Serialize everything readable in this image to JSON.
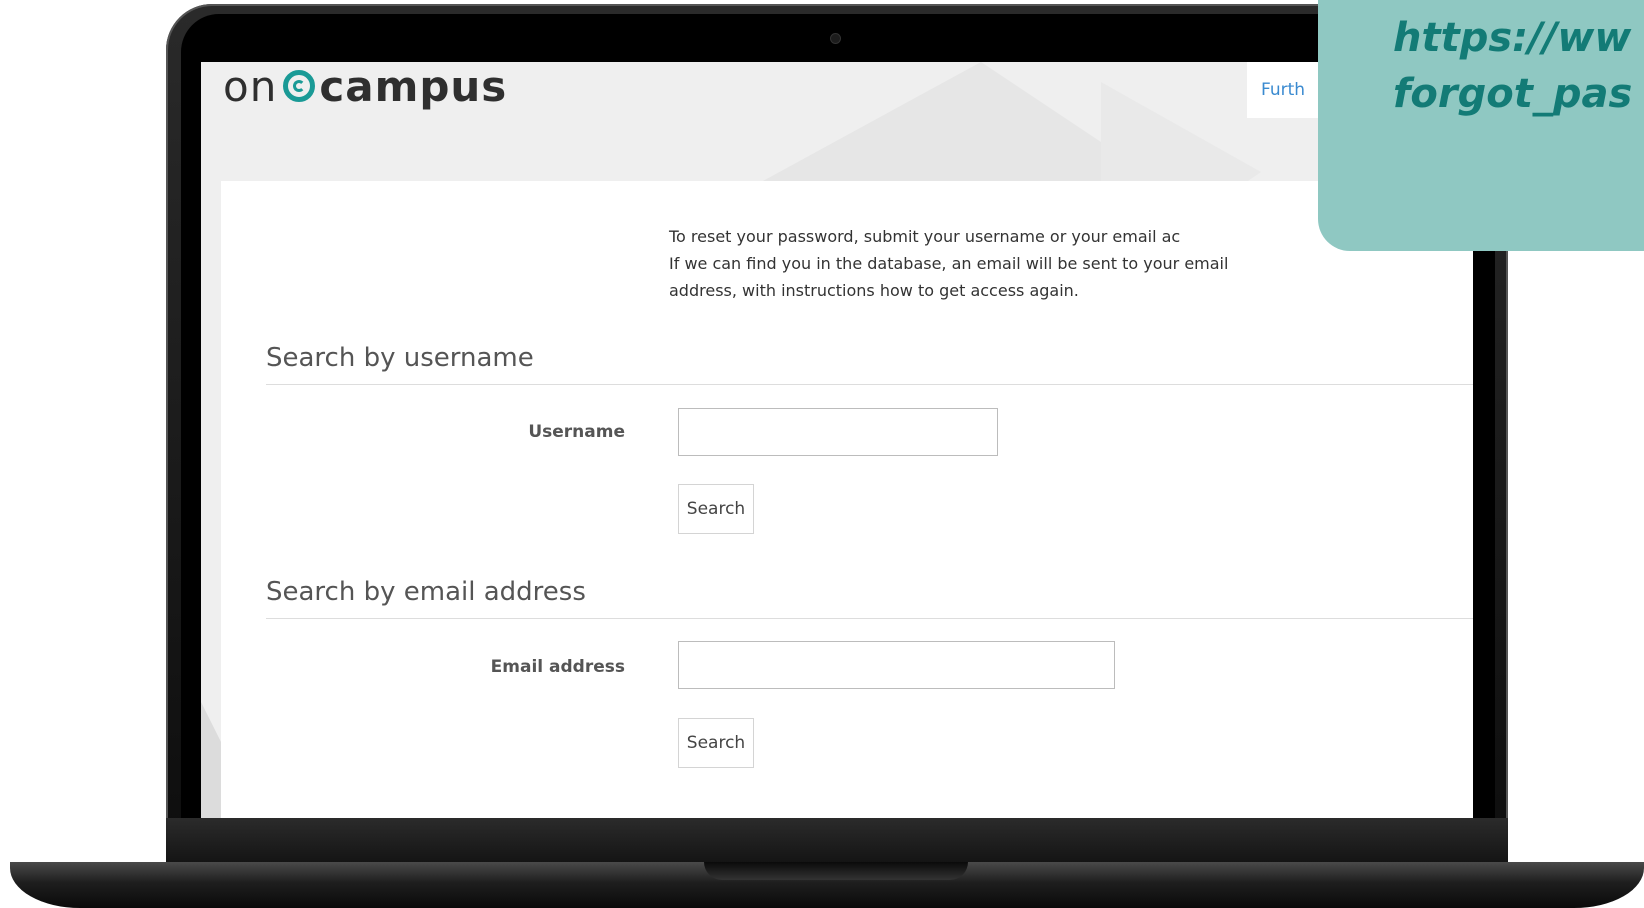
{
  "logo": {
    "prefix": "on",
    "suffix": "campus"
  },
  "header": {
    "further_link": "Furth"
  },
  "intro": {
    "text": "To reset your password, submit your username or your email ac\nIf we can find you in the database, an email will be sent to your email\naddress, with instructions how to get access again."
  },
  "username_section": {
    "title": "Search by username",
    "label": "Username",
    "value": "",
    "button": "Search"
  },
  "email_section": {
    "title": "Search by email address",
    "label": "Email address",
    "value": "",
    "button": "Search"
  },
  "url_overlay": {
    "text": "https://ww\nforgot_pas"
  },
  "colors": {
    "accent_teal": "#1a9a96",
    "overlay_bg": "#8fc8c2",
    "overlay_text": "#137b76",
    "link_blue": "#3a8ad0"
  },
  "icons": [
    "oncampus-logo-icon",
    "camera-icon"
  ]
}
